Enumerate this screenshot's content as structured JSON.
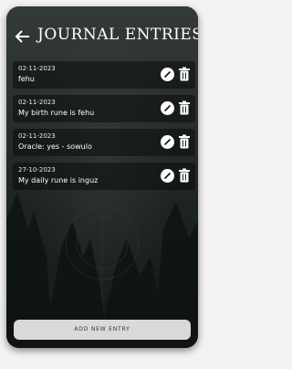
{
  "header": {
    "title": "JOURNAL ENTRIES",
    "back_icon": "arrow-left-icon"
  },
  "entries": [
    {
      "date": "02-11-2023",
      "text": "fehu"
    },
    {
      "date": "02-11-2023",
      "text": "My birth rune is fehu"
    },
    {
      "date": "02-11-2023",
      "text": "Oracle: yes - sowulo"
    },
    {
      "date": "27-10-2023",
      "text": "My daily rune is inguz"
    }
  ],
  "actions": {
    "edit_icon": "pencil-icon",
    "delete_icon": "trash-icon"
  },
  "footer": {
    "add_label": "ADD NEW ENTRY"
  },
  "colors": {
    "panel_bg": "#1e2321",
    "button_bg": "#d9d9d9",
    "text": "#ffffff"
  }
}
